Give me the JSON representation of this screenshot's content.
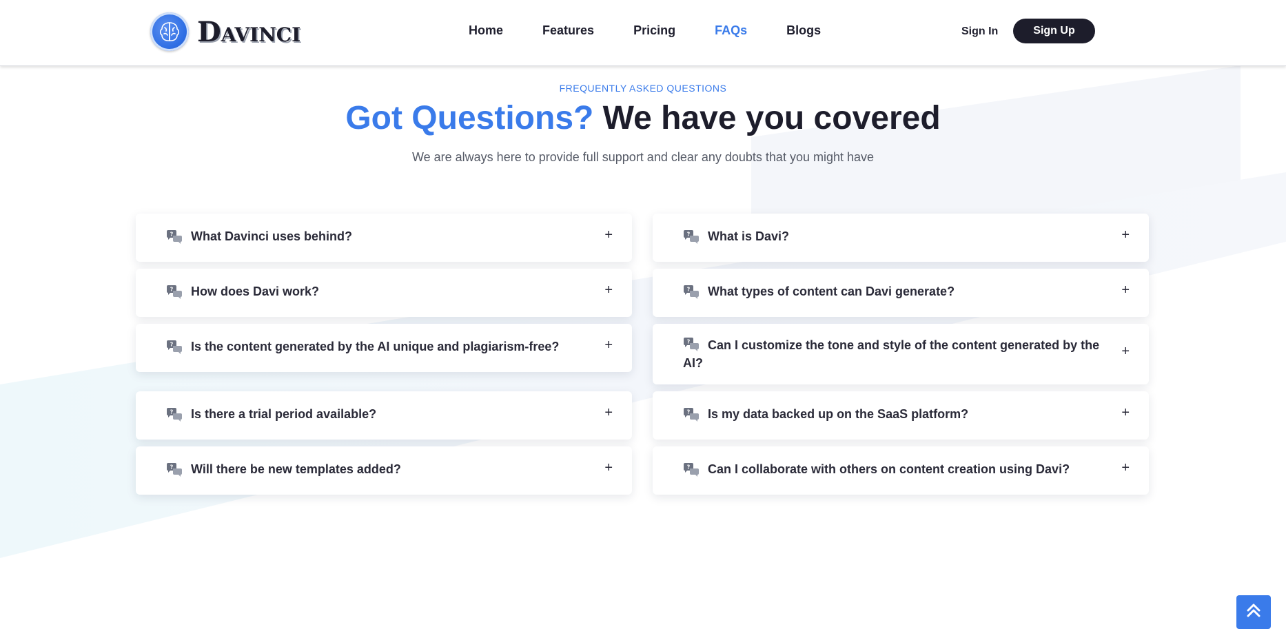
{
  "brand": {
    "name": "Davinci",
    "accent_color": "#3a7bea",
    "dark_color": "#1d1d2b"
  },
  "nav": {
    "items": [
      {
        "label": "Home",
        "active": false
      },
      {
        "label": "Features",
        "active": false
      },
      {
        "label": "Pricing",
        "active": false
      },
      {
        "label": "FAQs",
        "active": true
      },
      {
        "label": "Blogs",
        "active": false
      }
    ],
    "sign_in": "Sign In",
    "sign_up": "Sign Up"
  },
  "hero": {
    "eyebrow": "FREQUENTLY ASKED QUESTIONS",
    "title_accent": "Got Questions?",
    "title_rest": "We have you covered",
    "subtitle": "We are always here to provide full support and clear any doubts that you might have"
  },
  "faq": {
    "icon": "chat-bubbles-icon",
    "expand_icon": "+",
    "left": [
      {
        "question": "What Davinci uses behind?"
      },
      {
        "question": "How does Davi work?"
      },
      {
        "question": "Is the content generated by the AI unique and plagiarism-free?"
      },
      {
        "question": "Is there a trial period available?"
      },
      {
        "question": "Will there be new templates added?"
      }
    ],
    "right": [
      {
        "question": "What is Davi?"
      },
      {
        "question": "What types of content can Davi generate?"
      },
      {
        "question": "Can I customize the tone and style of the content generated by the AI?"
      },
      {
        "question": "Is my data backed up on the SaaS platform?"
      },
      {
        "question": "Can I collaborate with others on content creation using Davi?"
      }
    ]
  },
  "back_to_top": {
    "icon": "double-chevron-up-icon"
  }
}
